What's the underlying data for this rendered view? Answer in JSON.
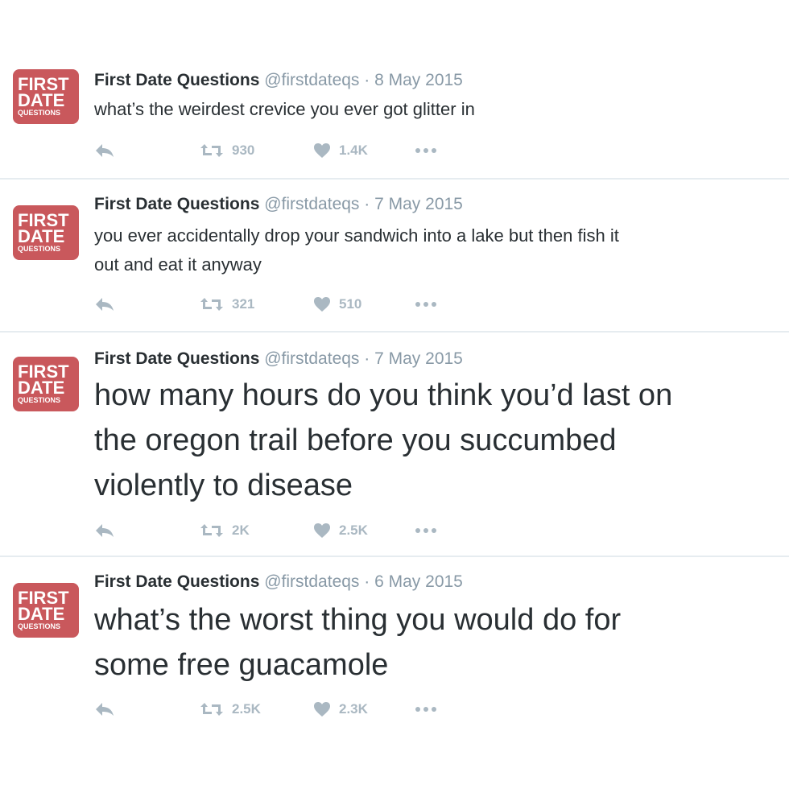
{
  "avatar": {
    "line1": "FIRST",
    "line2": "DATE",
    "line3": "QUESTIONS",
    "color": "#c9585c"
  },
  "colors": {
    "text": "#292f33",
    "meta": "#8899a6",
    "icon": "#aab8c2",
    "divider": "#e6ecf0"
  },
  "tweets": [
    {
      "name": "First Date Questions",
      "handle": "@firstdateqs",
      "separator": "·",
      "date": "8 May 2015",
      "lines": [
        "what’s the weirdest crevice you ever got glitter in"
      ],
      "retweets": "930",
      "likes": "1.4K"
    },
    {
      "name": "First Date Questions",
      "handle": "@firstdateqs",
      "separator": "·",
      "date": "7 May 2015",
      "lines": [
        "you ever accidentally drop your sandwich into a lake but then fish it",
        "out and eat it anyway"
      ],
      "retweets": "321",
      "likes": "510"
    },
    {
      "name": "First Date Questions",
      "handle": "@firstdateqs",
      "separator": "·",
      "date": "7 May 2015",
      "lines": [
        "how many hours do you think you’d last on",
        "the oregon trail before you succumbed",
        "violently to disease"
      ],
      "retweets": "2K",
      "likes": "2.5K"
    },
    {
      "name": "First Date Questions",
      "handle": "@firstdateqs",
      "separator": "·",
      "date": "6 May 2015",
      "lines": [
        "what’s the worst thing you would do for",
        "some free guacamole"
      ],
      "retweets": "2.5K",
      "likes": "2.3K"
    }
  ]
}
